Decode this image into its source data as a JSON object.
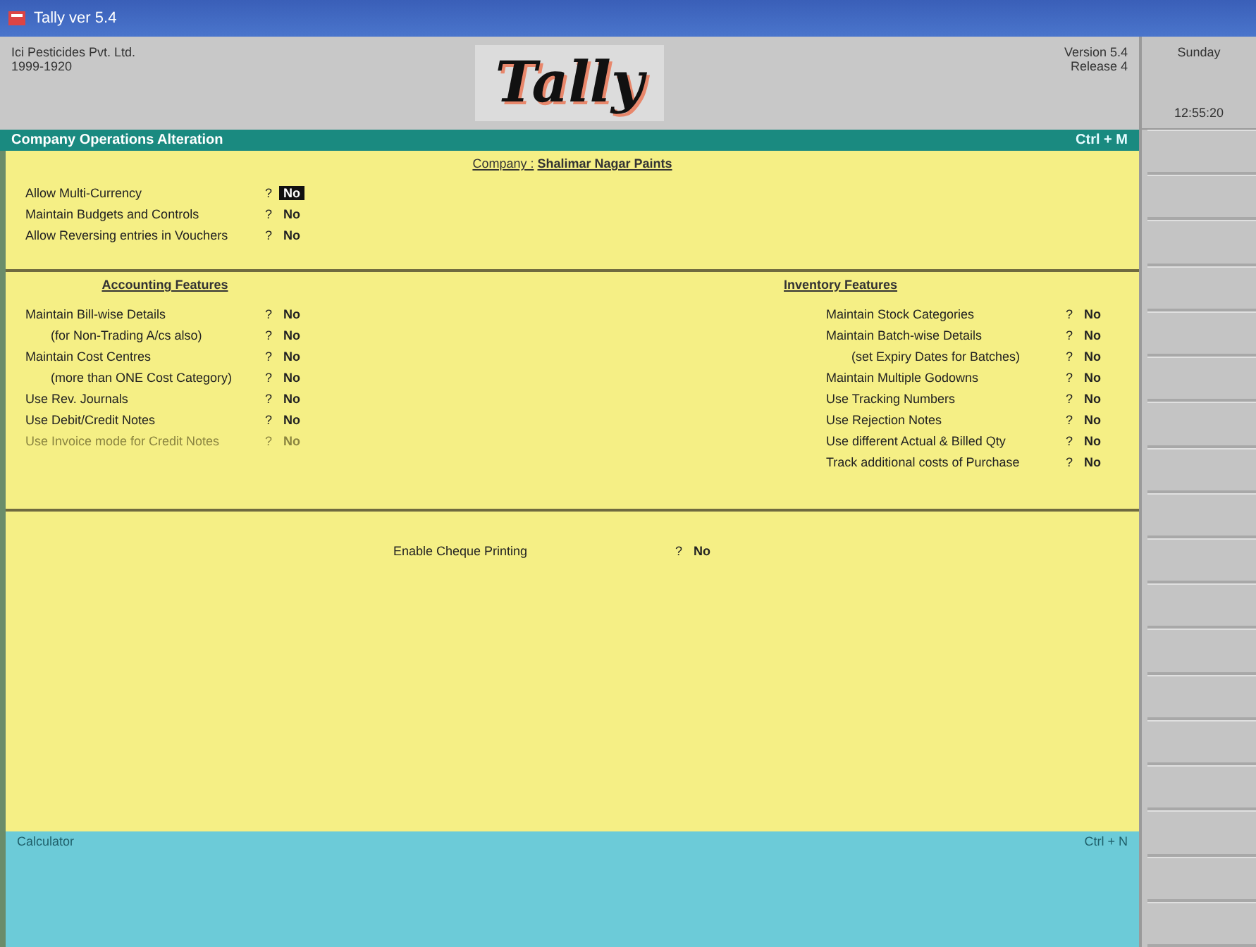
{
  "window": {
    "title": "Tally ver 5.4"
  },
  "header": {
    "company_name": "Ici Pesticides Pvt. Ltd.",
    "period": "1999-1920",
    "logo": "Tally",
    "version": "Version 5.4",
    "release": "Release 4"
  },
  "side_panel": {
    "day": "Sunday",
    "time": "12:55:20"
  },
  "screen_bar": {
    "title": "Company Operations Alteration",
    "shortcut": "Ctrl + M"
  },
  "company_line": {
    "label": "Company :",
    "name": "Shalimar Nagar Paints"
  },
  "general": [
    {
      "label": "Allow Multi-Currency",
      "prompt": "?",
      "value": "No",
      "selected": true
    },
    {
      "label": "Maintain Budgets and Controls",
      "prompt": "?",
      "value": "No",
      "selected": false
    },
    {
      "label": "Allow Reversing entries in Vouchers",
      "prompt": "?",
      "value": "No",
      "selected": false
    }
  ],
  "accounting": {
    "heading": "Accounting Features",
    "items": [
      {
        "label": "Maintain Bill-wise Details",
        "prompt": "?",
        "value": "No",
        "disabled": false,
        "indented": false
      },
      {
        "label": "(for Non-Trading A/cs also)",
        "prompt": "?",
        "value": "No",
        "disabled": false,
        "indented": true
      },
      {
        "label": "Maintain Cost Centres",
        "prompt": "?",
        "value": "No",
        "disabled": false,
        "indented": false
      },
      {
        "label": "(more than ONE Cost Category)",
        "prompt": "?",
        "value": "No",
        "disabled": false,
        "indented": true
      },
      {
        "label": "Use Rev. Journals",
        "prompt": "?",
        "value": "No",
        "disabled": false,
        "indented": false
      },
      {
        "label": "Use Debit/Credit Notes",
        "prompt": "?",
        "value": "No",
        "disabled": false,
        "indented": false
      },
      {
        "label": "Use Invoice mode for Credit Notes",
        "prompt": "?",
        "value": "No",
        "disabled": true,
        "indented": false
      }
    ]
  },
  "inventory": {
    "heading": "Inventory Features",
    "items": [
      {
        "label": "Maintain Stock Categories",
        "prompt": "?",
        "value": "No",
        "indented": false
      },
      {
        "label": "Maintain Batch-wise Details",
        "prompt": "?",
        "value": "No",
        "indented": false
      },
      {
        "label": "(set Expiry Dates for Batches)",
        "prompt": "?",
        "value": "No",
        "indented": true
      },
      {
        "label": "Maintain Multiple Godowns",
        "prompt": "?",
        "value": "No",
        "indented": false
      },
      {
        "label": "Use Tracking Numbers",
        "prompt": "?",
        "value": "No",
        "indented": false
      },
      {
        "label": "Use Rejection Notes",
        "prompt": "?",
        "value": "No",
        "indented": false
      },
      {
        "label": "Use different Actual & Billed Qty",
        "prompt": "?",
        "value": "No",
        "indented": false
      },
      {
        "label": "Track additional costs of Purchase",
        "prompt": "?",
        "value": "No",
        "indented": false
      }
    ]
  },
  "other": [
    {
      "label": "Enable Cheque Printing",
      "prompt": "?",
      "value": "No"
    }
  ],
  "calculator": {
    "title": "Calculator",
    "shortcut": "Ctrl + N"
  }
}
